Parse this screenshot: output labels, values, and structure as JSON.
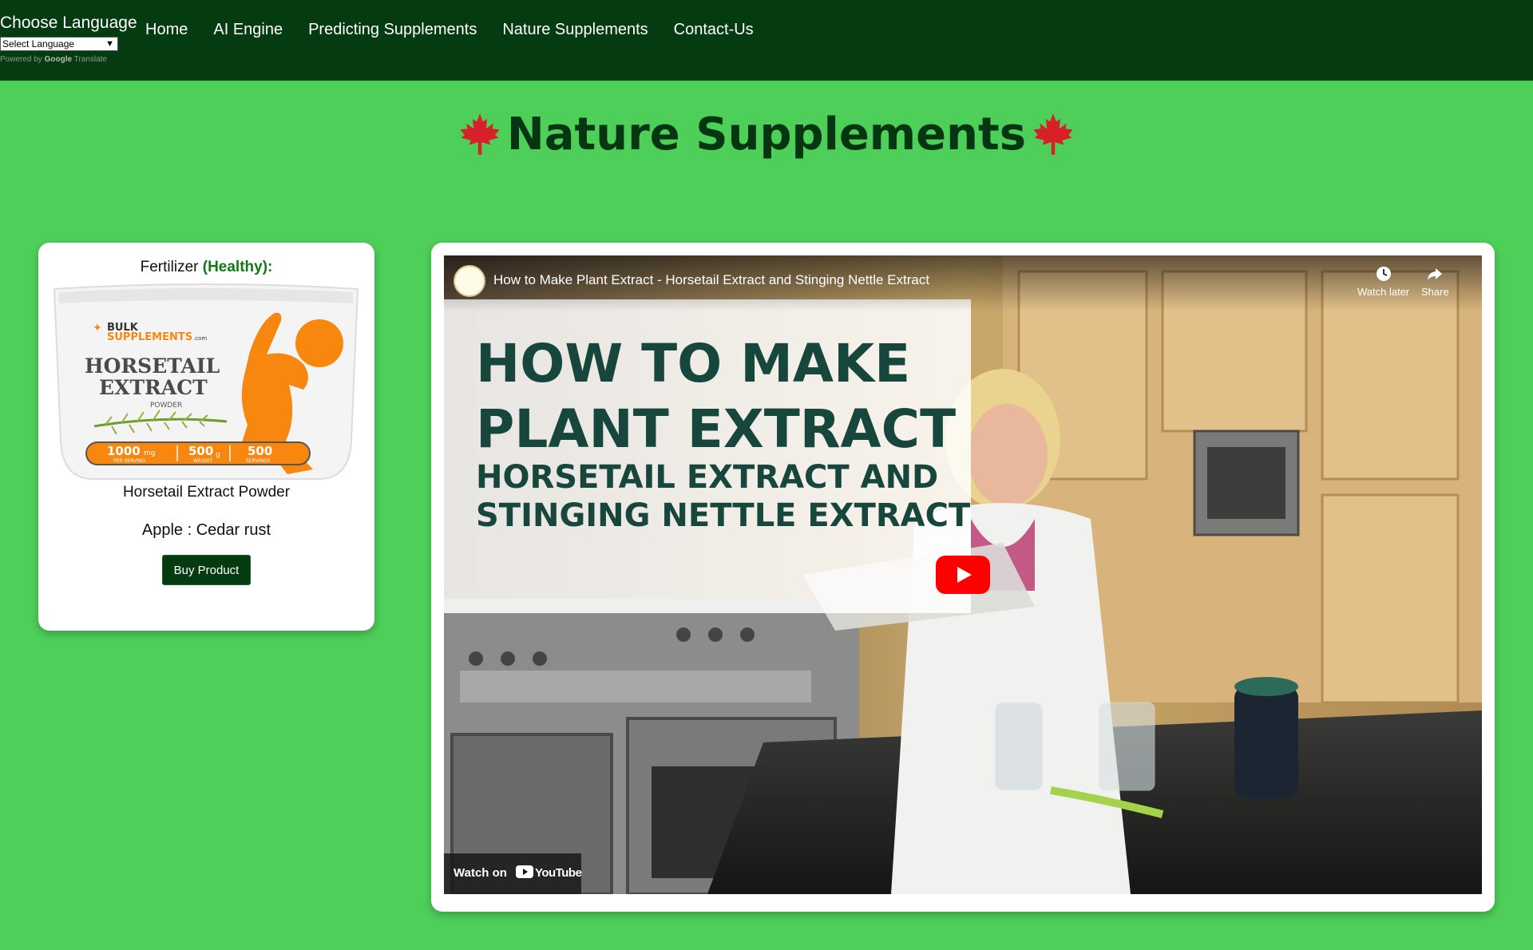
{
  "nav": {
    "language": {
      "title": "Choose Language",
      "select_value": "Select Language",
      "powered_prefix": "Powered by",
      "powered_brand": "Google",
      "powered_suffix": "Translate"
    },
    "links": [
      "Home",
      "AI Engine",
      "Predicting Supplements",
      "Nature Supplements",
      "Contact-Us"
    ]
  },
  "page": {
    "title": "Nature Supplements",
    "title_icon": "maple-leaf-icon"
  },
  "product_card": {
    "label_prefix": "Fertilizer",
    "label_status": "(Healthy):",
    "product_name": "Horsetail Extract Powder",
    "disease": "Apple : Cedar rust",
    "button": "Buy Product",
    "image": {
      "brand_line1": "BULK",
      "brand_line2": "SUPPLEMENTS",
      "brand_suffix": ".com",
      "name_line1": "HORSETAIL",
      "name_line2": "EXTRACT",
      "form": "POWDER",
      "stats": [
        {
          "value": "1000",
          "unit": "mg",
          "label": "PER SERVING"
        },
        {
          "value": "500",
          "unit": "g",
          "label": "WEIGHT"
        },
        {
          "value": "500",
          "unit": "",
          "label": "SERVINGS"
        }
      ]
    }
  },
  "video": {
    "title": "How to Make Plant Extract - Horsetail Extract and Stinging Nettle Extract",
    "watch_later": "Watch later",
    "share": "Share",
    "overlay_lines": [
      "HOW TO MAKE",
      "PLANT EXTRACT",
      "HORSETAIL EXTRACT AND",
      "STINGING NETTLE EXTRACT"
    ],
    "watch_on": "Watch on",
    "youtube": "YouTube"
  },
  "colors": {
    "page_background": "#4ecf5a",
    "navbar": "#053b10",
    "heading": "#063512",
    "healthy": "#127a12",
    "button": "#053b10"
  }
}
